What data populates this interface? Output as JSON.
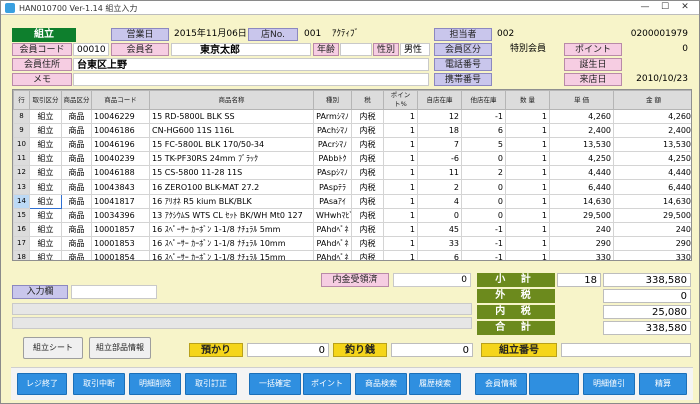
{
  "window": {
    "title": "HAN010700 Ver-1.14 組立入力",
    "min": "—",
    "max": "☐",
    "close": "✕"
  },
  "header": {
    "mode": "組立",
    "business_day_label": "営業日",
    "business_day": "2015年11月06日",
    "store_label": "店No.",
    "store_no": "001",
    "store_name": "ｱｸﾃｨﾌﾞ",
    "staff_label": "担当者",
    "staff_no": "002",
    "slip_no": "0200001979",
    "member_code_label": "会員コード",
    "member_code": "00010",
    "member_name_label": "会員名",
    "member_name": "東京太郎",
    "age_label": "年齢",
    "gender_label": "性別",
    "gender": "男性",
    "member_class_label": "会員区分",
    "member_class": "特別会員",
    "points_label": "ポイント",
    "points": "0",
    "address_label": "会員住所",
    "address": "台東区上野",
    "phone_label": "電話番号",
    "birthday_label": "誕生日",
    "memo_label": "メモ",
    "mobile_label": "携帯番号",
    "visit_label": "来店日",
    "visit_date": "2010/10/23"
  },
  "table": {
    "columns": [
      "行",
      "取引区分",
      "商品区分",
      "商品コード",
      "商品名称",
      "種別",
      "税",
      "ポイント%",
      "自店在庫",
      "他店在庫",
      "数 量",
      "単 価",
      "金 額"
    ],
    "rows": [
      [
        "8",
        "組立",
        "商品",
        "10046229",
        "15 RD-5800L BLK SS",
        "PArmｼﾏﾉ",
        "内税",
        "1",
        "12",
        "-1",
        "1",
        "4,260",
        "4,260"
      ],
      [
        "9",
        "組立",
        "商品",
        "10046186",
        "CN-HG600 11S 116L",
        "PAchｼﾏﾉ",
        "内税",
        "1",
        "18",
        "6",
        "1",
        "2,400",
        "2,400"
      ],
      [
        "10",
        "組立",
        "商品",
        "10046196",
        "15 FC-5800L BLK 170/50-34",
        "PAcrｼﾏﾉ",
        "内税",
        "1",
        "7",
        "5",
        "1",
        "13,530",
        "13,530"
      ],
      [
        "11",
        "組立",
        "商品",
        "10040239",
        "15 TK-PF30RS 24mm ﾌﾞﾗｯｸ",
        "PAbbﾄｸ",
        "内税",
        "1",
        "-6",
        "0",
        "1",
        "4,250",
        "4,250"
      ],
      [
        "12",
        "組立",
        "商品",
        "10046188",
        "15 CS-5800 11-28 11S",
        "PAspｼﾏﾉ",
        "内税",
        "1",
        "11",
        "2",
        "1",
        "4,440",
        "4,440"
      ],
      [
        "13",
        "組立",
        "商品",
        "10043843",
        "16 ZERO100 BLK-MAT 27.2",
        "PAspﾃﾗ",
        "内税",
        "1",
        "2",
        "0",
        "1",
        "6,440",
        "6,440"
      ],
      [
        "14",
        "組立",
        "商品",
        "10041817",
        "16 ｱﾘｵﾈ R5 kium BLK/BLK",
        "PAsaｱｲ",
        "内税",
        "1",
        "4",
        "0",
        "1",
        "14,630",
        "14,630"
      ],
      [
        "15",
        "組立",
        "商品",
        "10034396",
        "13 ｱｸｼｳﾑS WTS CL ｾｯﾄ BK/WH Mt0 127",
        "WHwhﾏﾋﾞ",
        "内税",
        "1",
        "0",
        "0",
        "1",
        "29,500",
        "29,500"
      ],
      [
        "16",
        "組立",
        "商品",
        "10001857",
        "16 ｽﾍﾟｰｻｰ ｶｰﾎﾞﾝ 1-1/8 ﾅﾁｭﾗﾙ 5mm",
        "PAhdﾍﾟﾈ",
        "内税",
        "1",
        "45",
        "-1",
        "1",
        "240",
        "240"
      ],
      [
        "17",
        "組立",
        "商品",
        "10001853",
        "16 ｽﾍﾟｰｻｰ ｶｰﾎﾞﾝ 1-1/8 ﾅﾁｭﾗﾙ 10mm",
        "PAhdﾍﾟﾈ",
        "内税",
        "1",
        "33",
        "-1",
        "1",
        "290",
        "290"
      ],
      [
        "18",
        "組立",
        "商品",
        "10001854",
        "16 ｽﾍﾟｰｻｰ ｶｰﾎﾞﾝ 1-1/8 ﾅﾁｭﾗﾙ 15mm",
        "PAhdﾍﾟﾈ",
        "内税",
        "1",
        "6",
        "-1",
        "1",
        "330",
        "330"
      ]
    ]
  },
  "summary": {
    "deposit_received_label": "内金受領済",
    "deposit_received": "0",
    "subtotal_label": "小 計",
    "subtotal_qty": "18",
    "subtotal": "338,580",
    "outer_tax_label": "外 税",
    "outer_tax": "0",
    "inner_tax_label": "内 税",
    "inner_tax": "25,080",
    "total_label": "合 計",
    "total": "338,580",
    "input_label": "入力欄",
    "deposit_label": "預かり",
    "deposit": "0",
    "change_label": "釣り銭",
    "change": "0",
    "assembly_no_label": "組立番号"
  },
  "buttons": {
    "assembly_sheet": "組立シート",
    "assembly_parts": "組立部品情報"
  },
  "fkeys": [
    "レジ終了",
    "取引中断",
    "明細削除",
    "取引訂正",
    "一括確定",
    "ポイント",
    "商品検索",
    "履歴検索",
    "会員情報",
    "",
    "明細値引",
    "精算"
  ],
  "colors": {
    "title_green": "#0e7f2d",
    "fkey_blue": "#2f8fe0",
    "label_pink": "#f6cde2",
    "label_purple": "#c9c6ec",
    "total_green": "#6c8a1d",
    "yellow": "#f5d51a",
    "bg": "#f7f4c9"
  }
}
